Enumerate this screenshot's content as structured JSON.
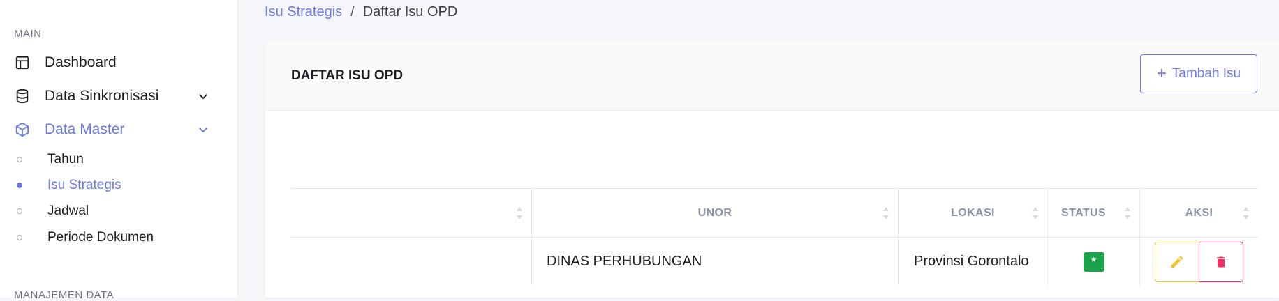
{
  "sidebar": {
    "section_main": "MAIN",
    "section_manajemen": "MANAJEMEN DATA",
    "items": [
      {
        "label": "Dashboard",
        "icon": "layout-icon"
      },
      {
        "label": "Data Sinkronisasi",
        "icon": "database-icon"
      },
      {
        "label": "Data Master",
        "icon": "box-icon"
      }
    ],
    "sub_items": [
      {
        "label": "Tahun"
      },
      {
        "label": "Isu Strategis"
      },
      {
        "label": "Jadwal"
      },
      {
        "label": "Periode Dokumen"
      }
    ]
  },
  "breadcrumb": {
    "parent": "Isu Strategis",
    "separator": "/",
    "current": "Daftar Isu OPD"
  },
  "card": {
    "title": "DAFTAR ISU OPD",
    "add_button": "Tambah Isu"
  },
  "table": {
    "headers": [
      "",
      "UNOR",
      "LOKASI",
      "STATUS",
      "AKSI"
    ],
    "rows": [
      {
        "unor": "DINAS PERHUBUNGAN",
        "lokasi": "Provinsi Gorontalo",
        "status": "*"
      }
    ]
  },
  "colors": {
    "accent": "#6c78e6",
    "status_green": "#1aa34a",
    "edit_yellow": "#f3c230",
    "delete_red": "#ef2e64"
  }
}
